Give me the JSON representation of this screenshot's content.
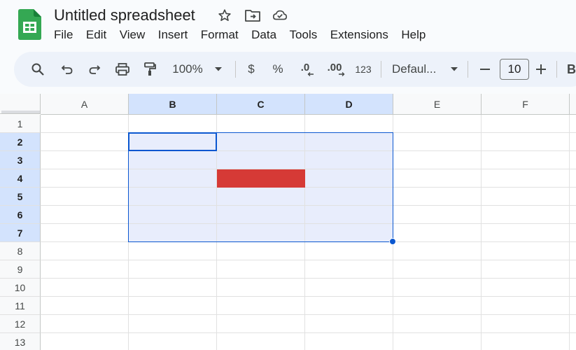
{
  "app": {
    "title": "Untitled spreadsheet",
    "title_icons": [
      "star-icon",
      "move-to-folder-icon",
      "cloud-saved-icon"
    ]
  },
  "menu": [
    "File",
    "Edit",
    "View",
    "Insert",
    "Format",
    "Data",
    "Tools",
    "Extensions",
    "Help"
  ],
  "toolbar": {
    "zoom": "100%",
    "currency_label": "$",
    "percent_label": "%",
    "decrease_decimal_label": ".0",
    "increase_decimal_label": ".00",
    "number_format_label": "123",
    "font_family": "Defaul...",
    "font_size": "10",
    "bold_label": "B"
  },
  "grid": {
    "columns": [
      "A",
      "B",
      "C",
      "D",
      "E",
      "F"
    ],
    "rows": [
      "1",
      "2",
      "3",
      "4",
      "5",
      "6",
      "7",
      "8",
      "9",
      "10",
      "11",
      "12",
      "13"
    ],
    "selected_range": "B2:D7",
    "active_cell": "B2",
    "filled_cell": "C4",
    "fill_color": "#d63a36",
    "selection_color": "#0b57d0"
  }
}
